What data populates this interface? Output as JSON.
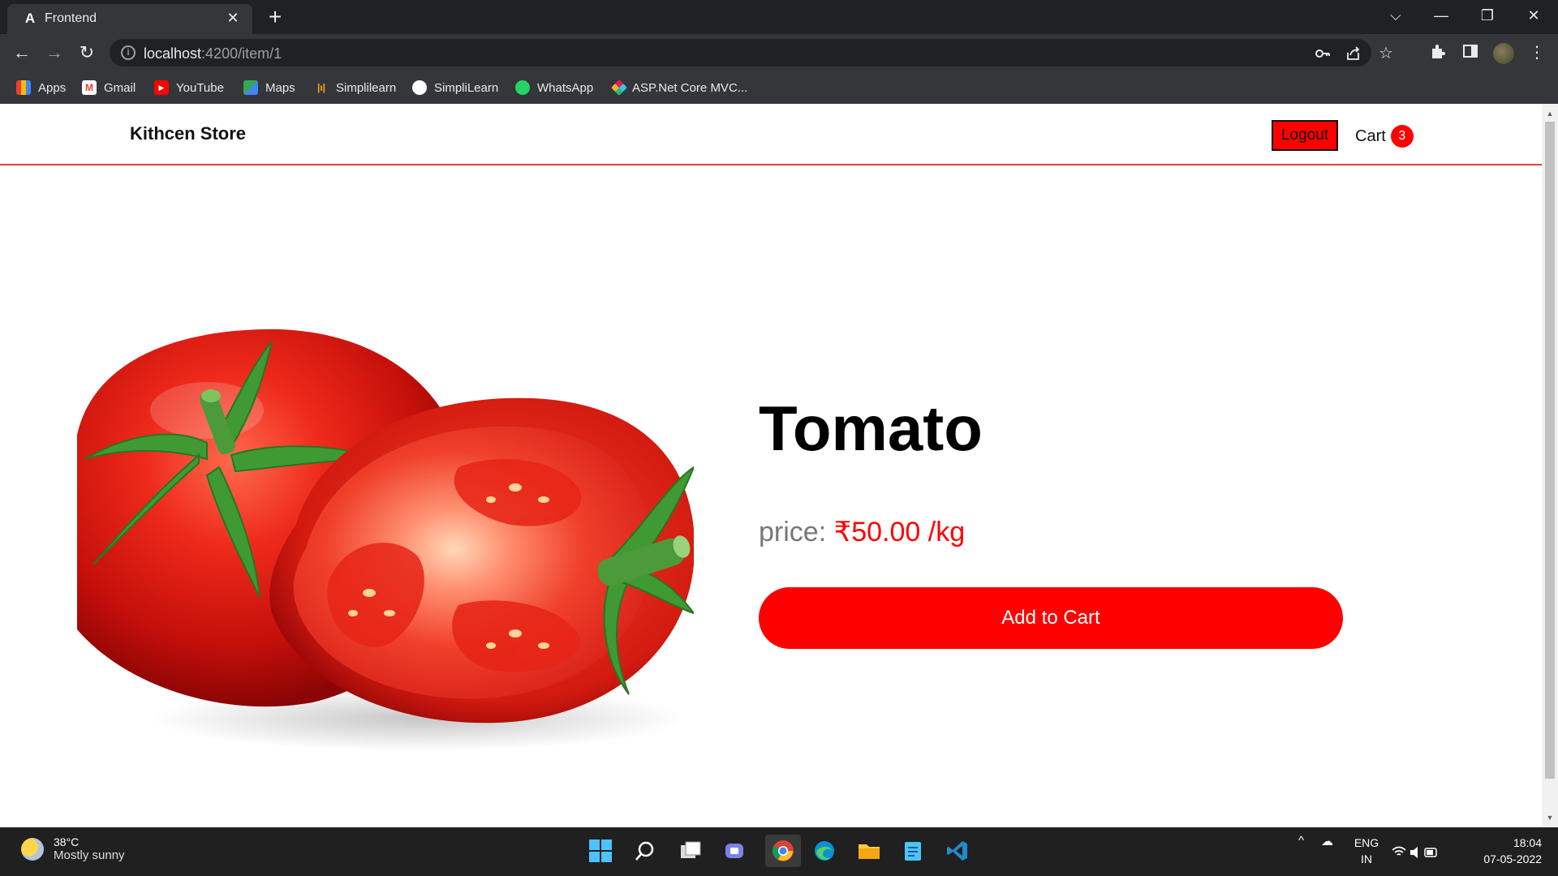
{
  "browser": {
    "tab": {
      "title": "Frontend",
      "favicon": "A",
      "close": "✕"
    },
    "new_tab": "+",
    "window_controls": {
      "minimize": "—",
      "restore": "❐",
      "close": "✕",
      "tab_search": "⌵"
    },
    "nav": {
      "back": "←",
      "forward": "→",
      "reload": "↻"
    },
    "url": {
      "host": "localhost",
      "rest": ":4200/item/1"
    },
    "bookmarks": [
      {
        "label": "Apps",
        "icon": "apps-grid-icon",
        "color": "#4285f4"
      },
      {
        "label": "Gmail",
        "icon": "gmail-icon",
        "color": "#ea4335"
      },
      {
        "label": "YouTube",
        "icon": "youtube-icon",
        "color": "#ff0000"
      },
      {
        "label": "Maps",
        "icon": "maps-icon",
        "color": "#34a853"
      },
      {
        "label": "Simplilearn",
        "icon": "simplilearn-icon",
        "color": "#f9a825"
      },
      {
        "label": "SimpliLearn",
        "icon": "github-icon",
        "color": "#ffffff"
      },
      {
        "label": "WhatsApp",
        "icon": "whatsapp-icon",
        "color": "#25d366"
      },
      {
        "label": "ASP.Net Core MVC...",
        "icon": "slack-icon",
        "color": "#e01e5a"
      }
    ]
  },
  "header": {
    "brand": "Kithcen Store",
    "logout_label": "Logout",
    "cart_label": "Cart",
    "cart_count": "3"
  },
  "product": {
    "name": "Tomato",
    "price_label": "price:",
    "price_value": "₹50.00 /kg",
    "add_to_cart_label": "Add to Cart",
    "image": "tomato-image"
  },
  "taskbar": {
    "weather_temp": "38°C",
    "weather_condition": "Mostly sunny",
    "lang_top": "ENG",
    "lang_bottom": "IN",
    "time": "18:04",
    "date": "07-05-2022"
  },
  "colors": {
    "accent": "#ff0000",
    "header_border": "#ee3b3b",
    "chrome_dark": "#202124",
    "chrome_mid": "#35363a"
  }
}
